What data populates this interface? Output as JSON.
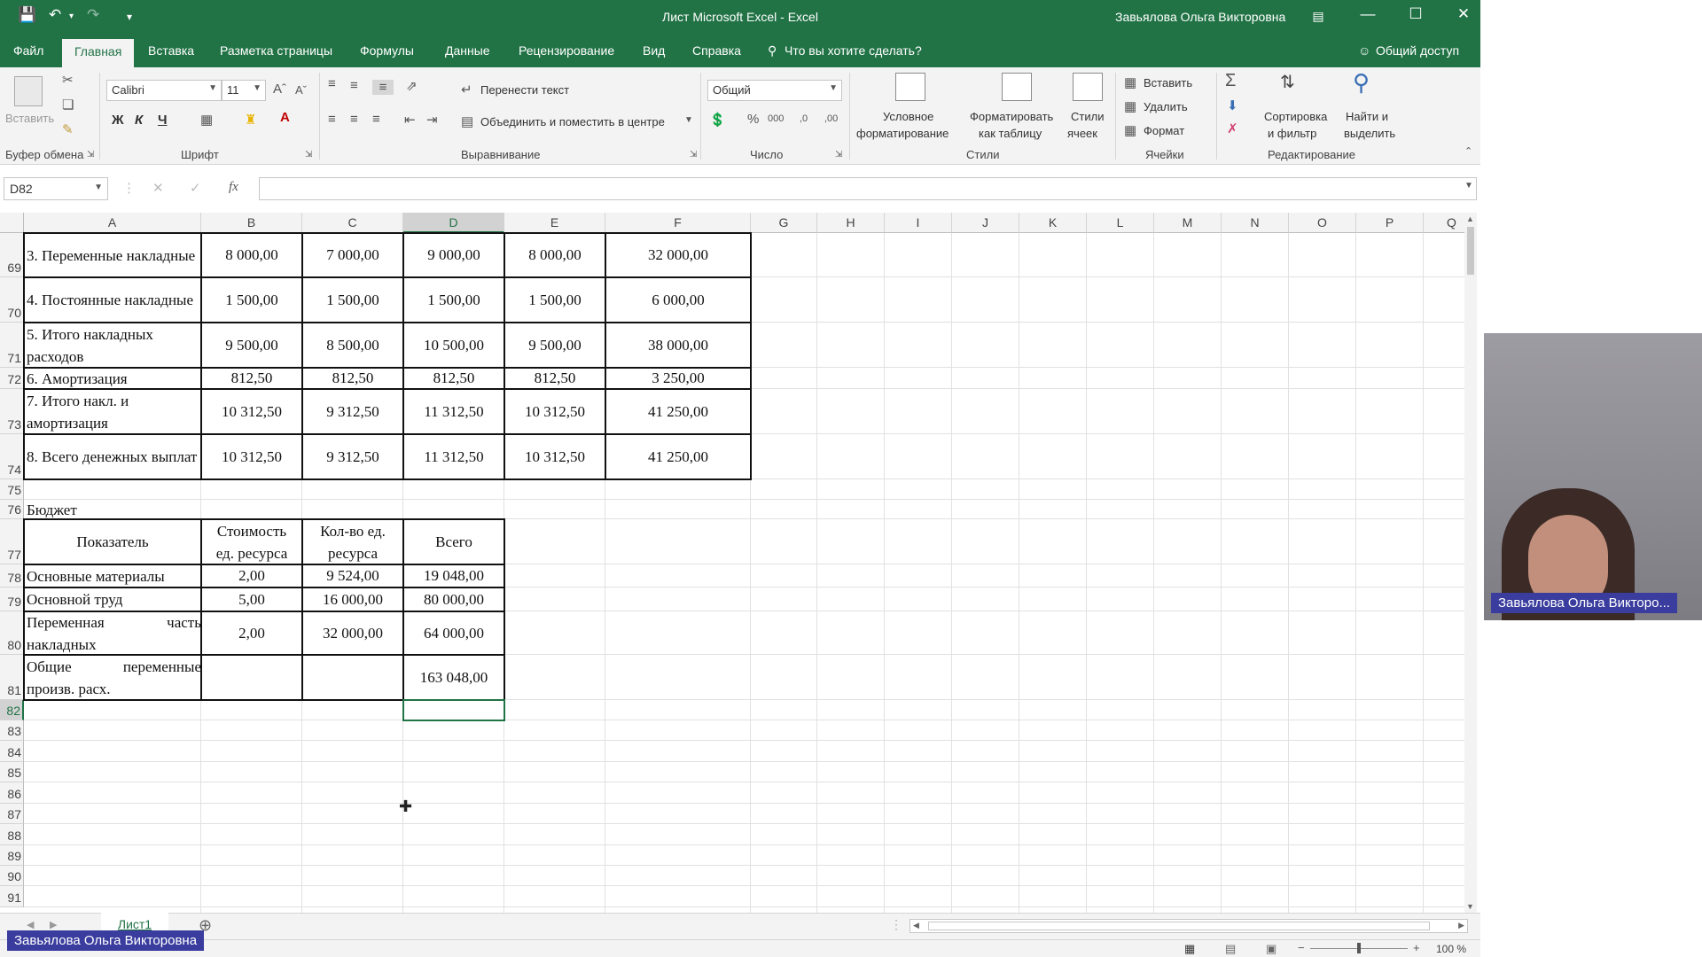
{
  "window": {
    "title": "Лист Microsoft Excel  -  Excel",
    "user": "Завьялова Ольга Викторовна"
  },
  "tabs": [
    "Файл",
    "Главная",
    "Вставка",
    "Разметка страницы",
    "Формулы",
    "Данные",
    "Рецензирование",
    "Вид",
    "Справка"
  ],
  "tell_me": "Что вы хотите сделать?",
  "share": "Общий доступ",
  "ribbon": {
    "paste": "Вставить",
    "clipboard": "Буфер обмена",
    "font_name": "Calibri",
    "font_size": "11",
    "bold": "Ж",
    "italic": "К",
    "underline": "Ч",
    "font_group": "Шрифт",
    "wrap_text": "Перенести текст",
    "merge_center": "Объединить и поместить в центре",
    "alignment_group": "Выравнивание",
    "number_format": "Общий",
    "number_group": "Число",
    "cond_format_1": "Условное",
    "cond_format_2": "форматирование",
    "format_table_1": "Форматировать",
    "format_table_2": "как таблицу",
    "cell_styles_1": "Стили",
    "cell_styles_2": "ячеек",
    "styles_group": "Стили",
    "insert": "Вставить",
    "delete": "Удалить",
    "format": "Формат",
    "cells_group": "Ячейки",
    "sort_1": "Сортировка",
    "sort_2": "и фильтр",
    "find_1": "Найти и",
    "find_2": "выделить",
    "editing_group": "Редактирование"
  },
  "formula_bar": {
    "name_box": "D82",
    "fx": "fx",
    "formula": ""
  },
  "columns": [
    "A",
    "B",
    "C",
    "D",
    "E",
    "F",
    "G",
    "H",
    "I",
    "J",
    "K",
    "L",
    "M",
    "N",
    "O",
    "P",
    "Q"
  ],
  "selected_column": "D",
  "selected_row": "82",
  "rows": [
    "69",
    "70",
    "71",
    "72",
    "73",
    "74",
    "75",
    "76",
    "77",
    "78",
    "79",
    "80",
    "81",
    "82",
    "83",
    "84",
    "85",
    "86",
    "87",
    "88",
    "89",
    "90",
    "91"
  ],
  "overhead_table": [
    {
      "label": "3. Переменные накладные",
      "b": "8 000,00",
      "c": "7 000,00",
      "d": "9 000,00",
      "e": "8 000,00",
      "f": "32 000,00"
    },
    {
      "label": "4. Постоянные накладные",
      "b": "1 500,00",
      "c": "1 500,00",
      "d": "1 500,00",
      "e": "1 500,00",
      "f": "6 000,00"
    },
    {
      "label": "5. Итого накладных расходов",
      "b": "9 500,00",
      "c": "8 500,00",
      "d": "10 500,00",
      "e": "9 500,00",
      "f": "38 000,00"
    },
    {
      "label": "6. Амортизация",
      "b": "812,50",
      "c": "812,50",
      "d": "812,50",
      "e": "812,50",
      "f": "3 250,00"
    },
    {
      "label": "7. Итого накл. и амортизация",
      "b": "10 312,50",
      "c": "9 312,50",
      "d": "11 312,50",
      "e": "10 312,50",
      "f": "41 250,00"
    },
    {
      "label": "8. Всего денежных выплат",
      "b": "10 312,50",
      "c": "9 312,50",
      "d": "11 312,50",
      "e": "10 312,50",
      "f": "41 250,00"
    }
  ],
  "budget_title": "Бюджет",
  "budget_table": {
    "headers": [
      "Показатель",
      "Стоимость ед. ресурса",
      "Кол-во ед. ресурса",
      "Всего"
    ],
    "rows": [
      {
        "label": "Основные материалы",
        "b": "2,00",
        "c": "9 524,00",
        "d": "19 048,00"
      },
      {
        "label": "Основной труд",
        "b": "5,00",
        "c": "16 000,00",
        "d": "80 000,00"
      },
      {
        "label": "Переменная часть накладных",
        "b": "2,00",
        "c": "32 000,00",
        "d": "64 000,00"
      },
      {
        "label": "Общие переменные произв. расх.",
        "b": "",
        "c": "",
        "d": "163 048,00"
      }
    ]
  },
  "sheet_tab": "Лист1",
  "zoom": "100 %",
  "presenter_caption": "Завьялова Ольга Викторовна",
  "video_caption": "Завьялова Ольга Викторо..."
}
